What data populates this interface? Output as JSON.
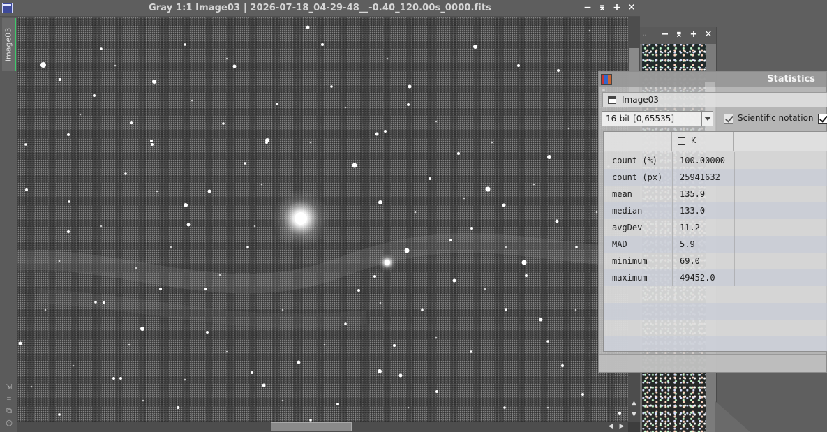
{
  "main_window": {
    "title": "Gray 1:1 Image03 | 2026-07-18_04-29-48__-0.40_120.00s_0000.fits",
    "side_tab": "Image03",
    "controls": {
      "minimize": "−",
      "shade": "⌆",
      "maximize": "+",
      "close": "✕"
    }
  },
  "background_window": {
    "title": "..",
    "controls": {
      "minimize": "−",
      "shade": "⌆",
      "maximize": "+",
      "close": "✕"
    }
  },
  "statistics": {
    "title": "Statistics",
    "view": "Image03",
    "range": "16-bit [0,65535]",
    "scientific_notation_label": "Scientific notation",
    "scientific_notation_checked": true,
    "channel_header": "K",
    "rows": [
      {
        "key": "count (%)",
        "value": "100.00000"
      },
      {
        "key": "count (px)",
        "value": "25941632"
      },
      {
        "key": "mean",
        "value": "135.9"
      },
      {
        "key": "median",
        "value": "133.0"
      },
      {
        "key": "avgDev",
        "value": "11.2"
      },
      {
        "key": "MAD",
        "value": "5.9"
      },
      {
        "key": "minimum",
        "value": "69.0"
      },
      {
        "key": "maximum",
        "value": "49452.0"
      }
    ]
  },
  "colors": {
    "accent_tab": "#3cc96a",
    "title_bar": "#5e5e5e",
    "image_background": "#3a3a3a"
  },
  "icons": {
    "window": "window-icon",
    "statistics": "statistics-icon",
    "view": "view-icon"
  }
}
